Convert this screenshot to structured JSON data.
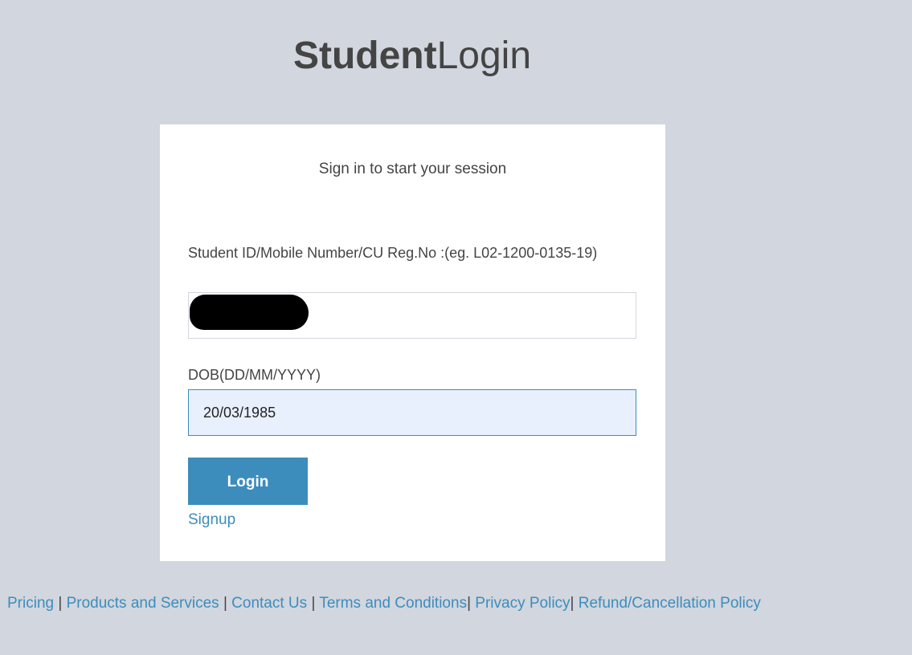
{
  "logo": {
    "bold": "Student",
    "light": "Login"
  },
  "login_box": {
    "message": "Sign in to start your session",
    "student_id": {
      "label": "Student ID/Mobile Number/CU Reg.No :(eg. L02-1200-0135-19)",
      "value": "",
      "redacted": true
    },
    "dob": {
      "label": "DOB(DD/MM/YYYY)",
      "value": "20/03/1985"
    },
    "login_button": "Login",
    "signup_link": "Signup"
  },
  "footer": {
    "links": [
      "Pricing",
      "Products and Services",
      "Contact Us",
      "Terms and Conditions",
      "Privacy Policy",
      "Refund/Cancellation Policy"
    ],
    "separator": "|"
  },
  "colors": {
    "background": "#d2d6de",
    "accent": "#3c8dbc",
    "autofill": "#e8f0fe"
  }
}
